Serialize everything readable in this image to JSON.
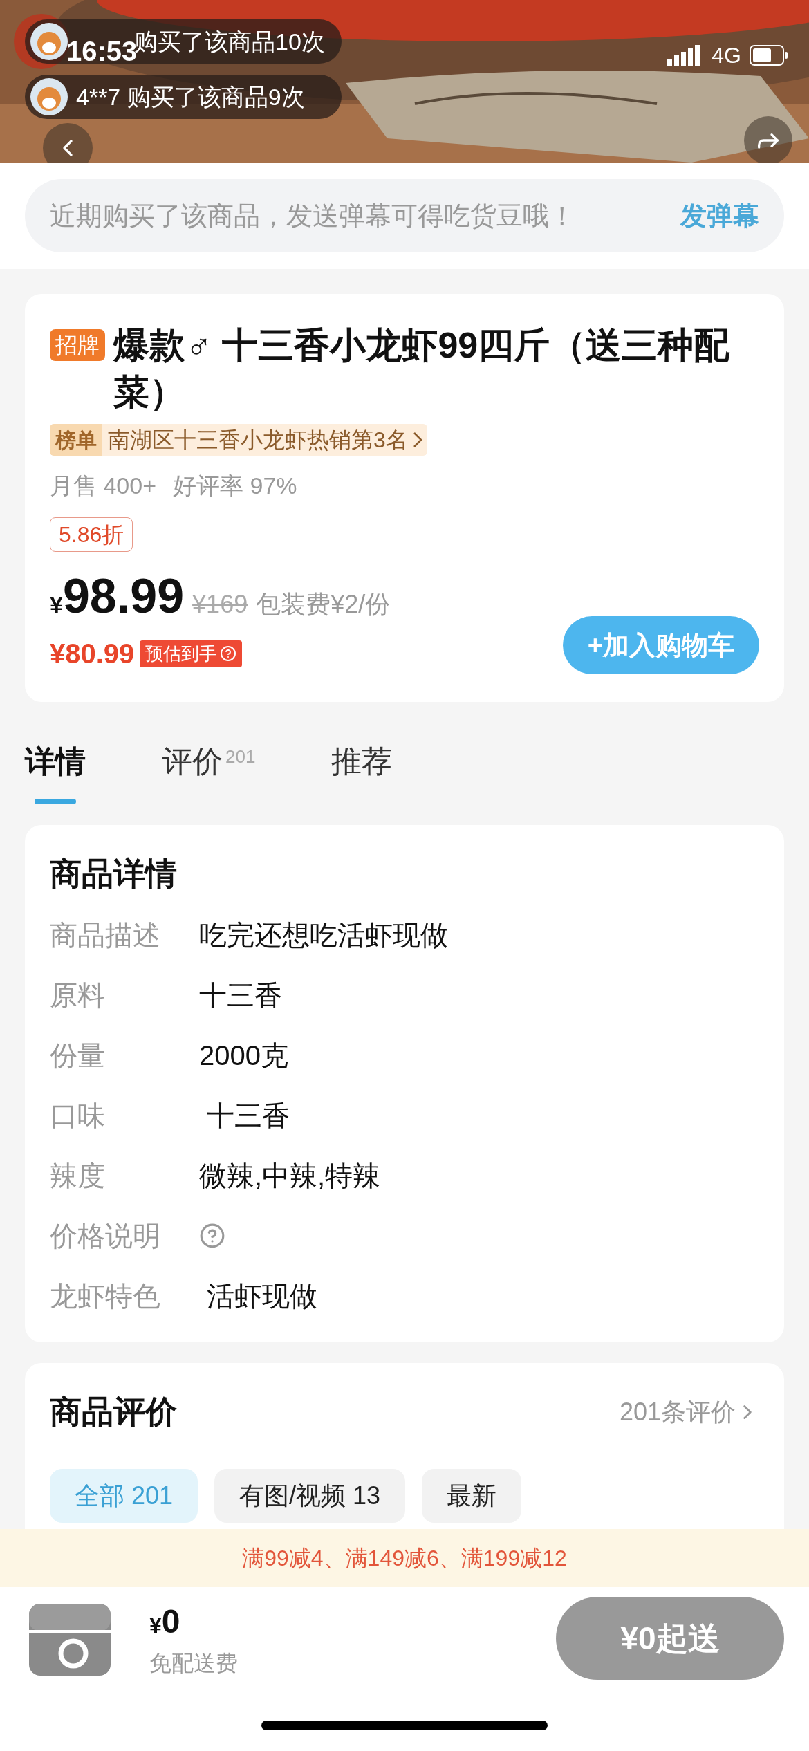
{
  "status_bar": {
    "time": "16:53",
    "network": "4G"
  },
  "danmaku": [
    {
      "text": "购买了该商品10次"
    },
    {
      "user": "4**7",
      "text": "购买了该商品9次"
    }
  ],
  "danmaku_bar": {
    "placeholder": "近期购买了该商品，发送弹幕可得吃货豆哦！",
    "send": "发弹幕"
  },
  "product": {
    "tag": "招牌",
    "title": "爆款♂ 十三香小龙虾99四斤（送三种配菜）",
    "rank_badge": "榜单",
    "rank_text": "南湖区十三香小龙虾热销第3名",
    "monthly_sales": "月售 400+",
    "rating": "好评率 97%",
    "discount": "5.86折",
    "currency": "¥",
    "price": "98.99",
    "original_price": "¥169",
    "packing_fee": "包装费¥2/份",
    "estimated_price": "¥80.99",
    "estimated_label": "预估到手",
    "add_to_cart": "+加入购物车"
  },
  "tabs": [
    {
      "label": "详情",
      "selected": true
    },
    {
      "label": "评价",
      "count": "201",
      "selected": false
    },
    {
      "label": "推荐",
      "selected": false
    }
  ],
  "details": {
    "title": "商品详情",
    "rows": [
      {
        "label": "商品描述",
        "value": "吃完还想吃活虾现做"
      },
      {
        "label": "原料",
        "value": "十三香"
      },
      {
        "label": "份量",
        "value": "2000克"
      },
      {
        "label": "口味",
        "value": " 十三香"
      },
      {
        "label": "辣度",
        "value": "微辣,中辣,特辣"
      },
      {
        "label": "价格说明",
        "kind": "help"
      },
      {
        "label": "龙虾特色",
        "value": " 活虾现做"
      }
    ]
  },
  "reviews": {
    "title": "商品评价",
    "link": "201条评价",
    "filters": [
      {
        "label": "全部 201",
        "selected": true
      },
      {
        "label": "有图/视频 13",
        "selected": false
      },
      {
        "label": "最新",
        "selected": false
      }
    ]
  },
  "promo": "满99减4、满149减6、满199减12",
  "cart": {
    "amount_currency": "¥",
    "amount": "0",
    "delivery": "免配送费",
    "checkout": "¥0起送"
  }
}
